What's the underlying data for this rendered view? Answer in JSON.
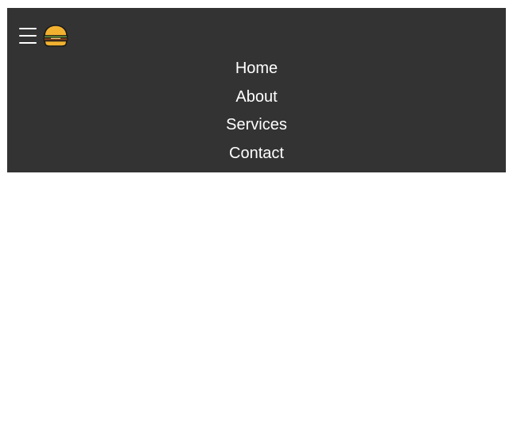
{
  "navbar": {
    "toggle_icon": "hamburger-menu-icon",
    "logo_icon": "hamburger-emoji-icon",
    "links": [
      {
        "label": "Home"
      },
      {
        "label": "About"
      },
      {
        "label": "Services"
      },
      {
        "label": "Contact"
      }
    ]
  },
  "colors": {
    "navbar_background": "#333333",
    "link_text": "#ffffff",
    "page_background": "#ffffff"
  }
}
